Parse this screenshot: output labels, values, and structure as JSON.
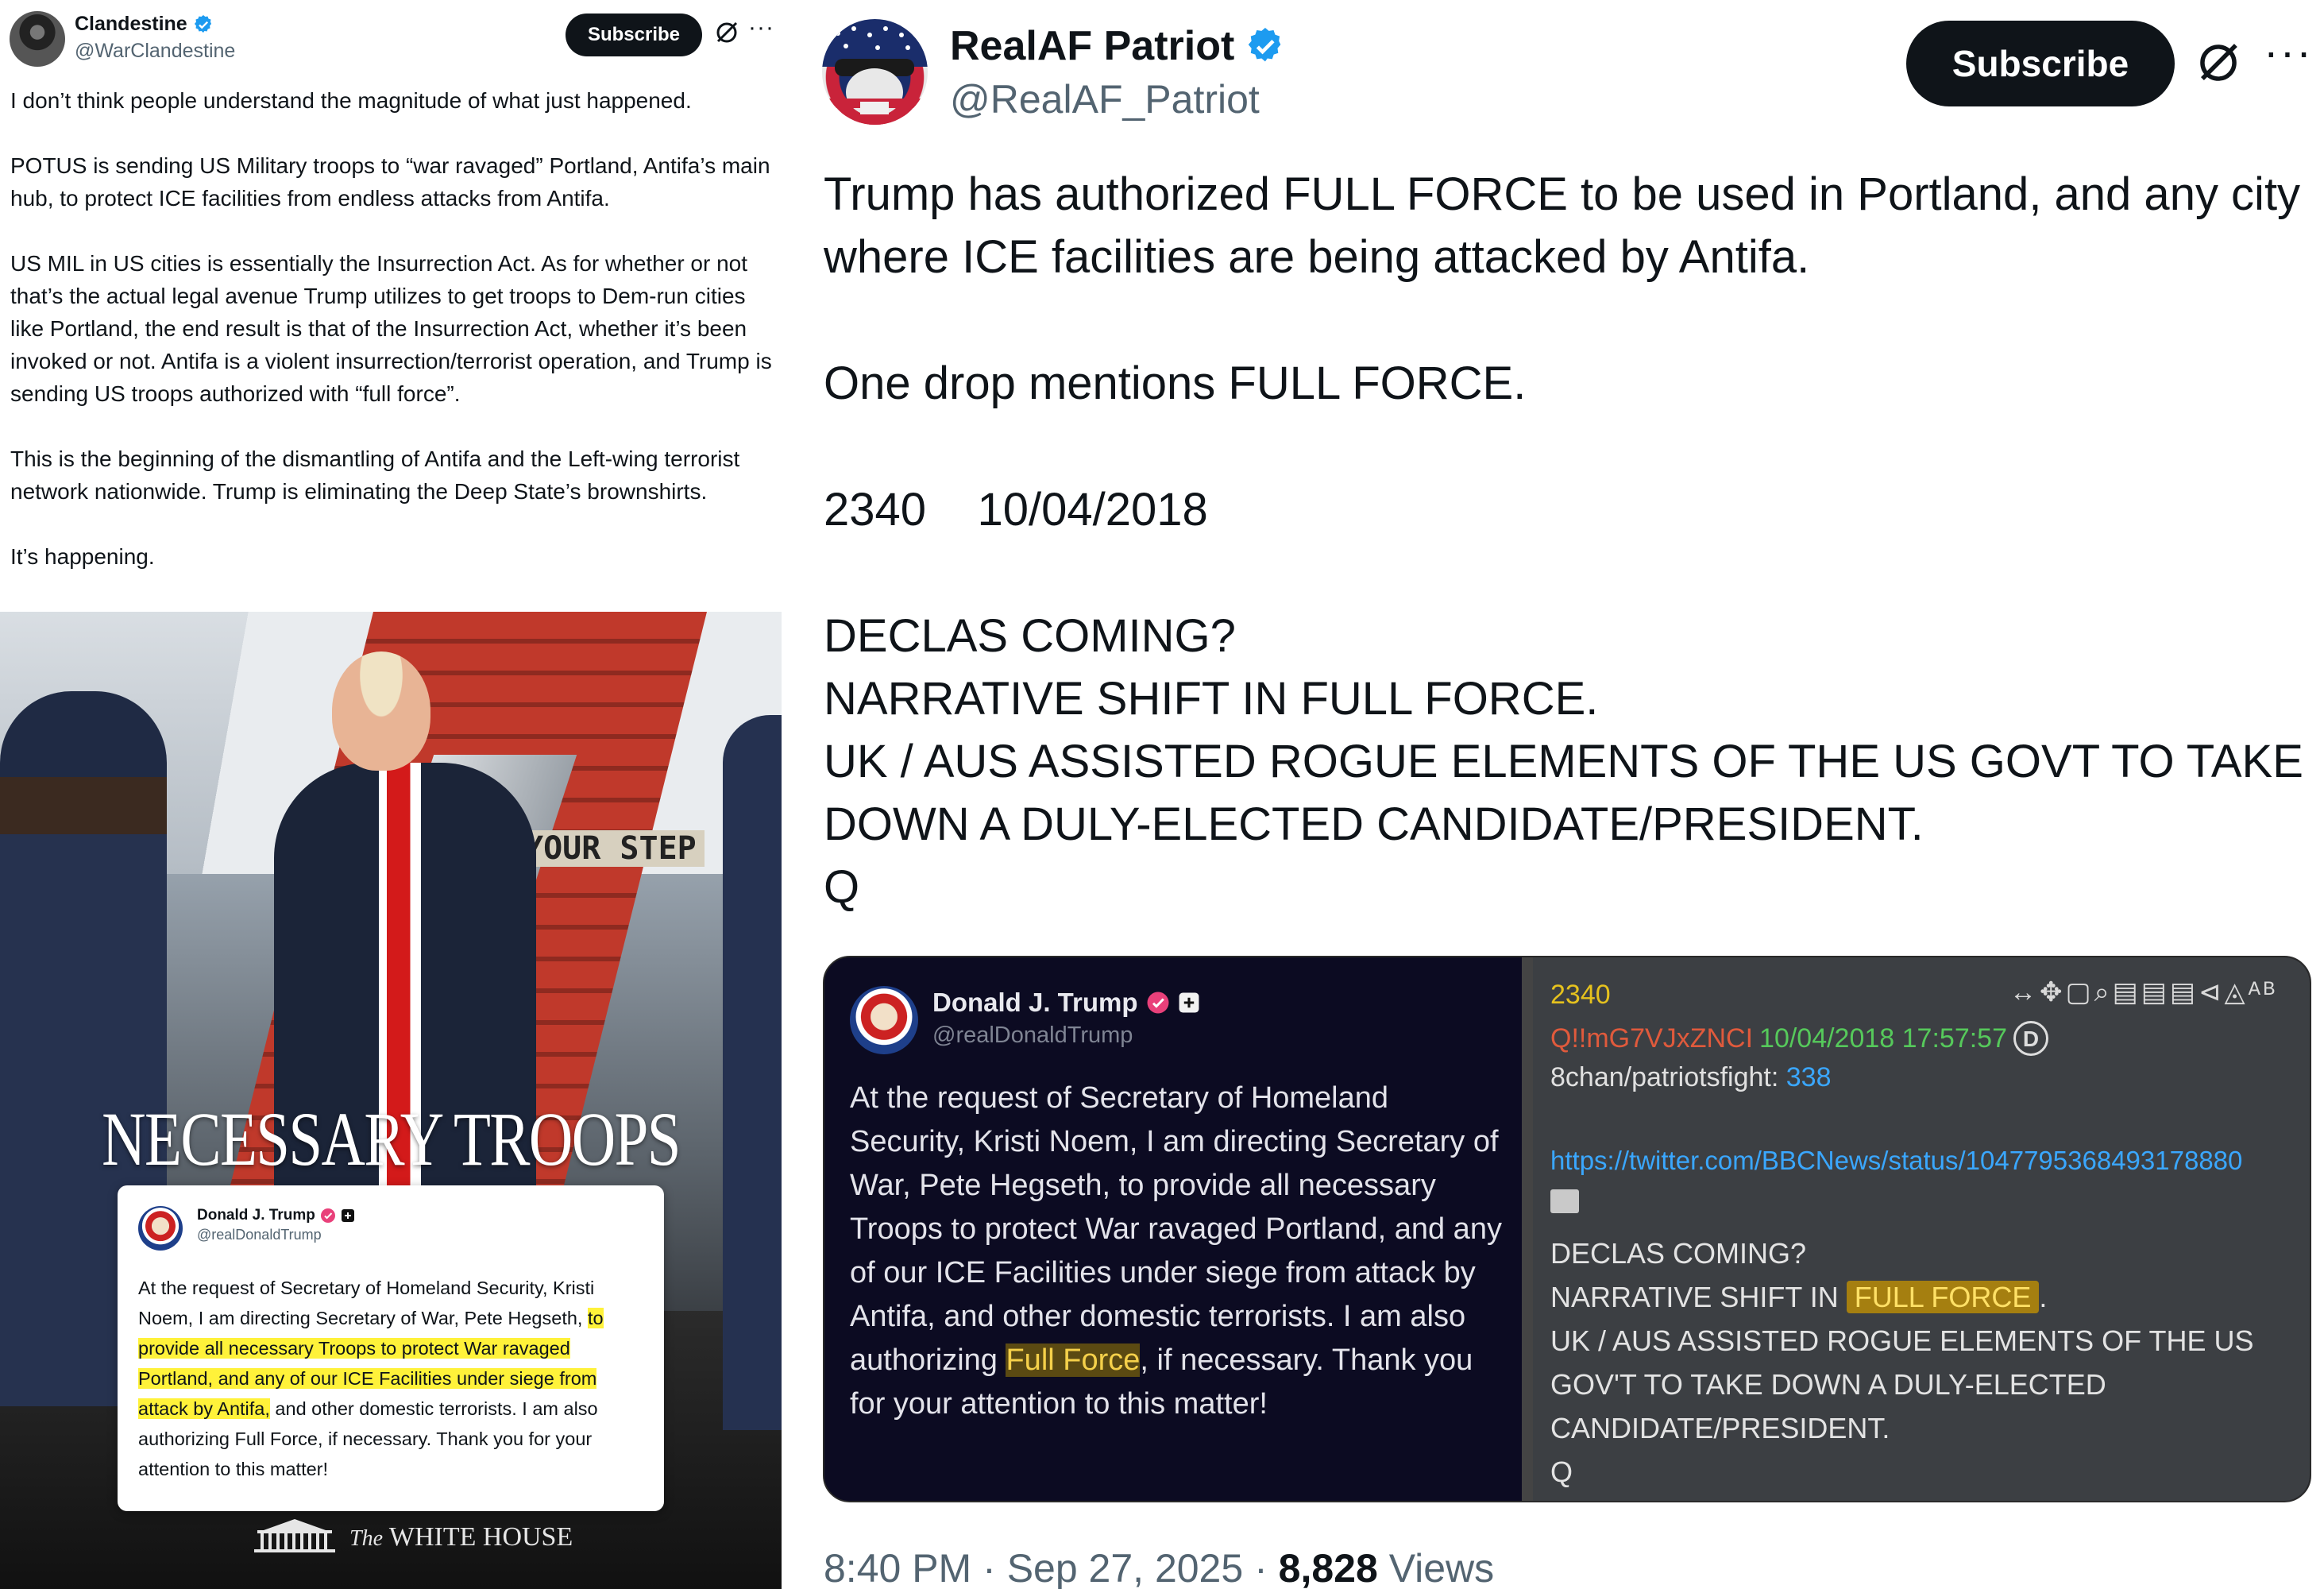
{
  "left_post": {
    "author_name": "Clandestine",
    "author_handle": "@WarClandestine",
    "subscribe_label": "Subscribe",
    "more_label": "···",
    "paragraphs": [
      "I don’t think people understand the magnitude of what just happened.",
      "POTUS is sending US Military troops to “war ravaged” Portland, Antifa’s main hub, to protect ICE facilities from endless attacks from Antifa.",
      "US MIL in US cities is essentially the Insurrection Act. As for whether or not that’s the actual legal avenue Trump utilizes to get troops to Dem-run cities like Portland, the end result is that of the Insurrection Act, whether it’s been invoked or not. Antifa is a violent insurrection/terrorist operation, and Trump is sending US troops authorized with “full force”.",
      "This is the beginning of the dismantling of Antifa and the Left-wing terrorist network nationwide. Trump is eliminating the Deep State’s brownshirts.",
      "It’s happening."
    ],
    "image": {
      "headline": "NECESSARY TROOPS",
      "stair_sign": "YOUR STEP",
      "card": {
        "name": "Donald J. Trump",
        "handle": "@realDonaldTrump",
        "body_before": "At the request of Secretary of Homeland Security, Kristi Noem, I am directing Secretary of War, Pete Hegseth, ",
        "body_highlight": "to provide all necessary Troops to protect War ravaged Portland, and any of our ICE Facilities under siege from attack by Antifa,",
        "body_after": " and other domestic terrorists. I am also authorizing Full Force, if necessary. Thank you for your attention to this matter!"
      },
      "footer_prefix": "The",
      "footer_text": "WHITE HOUSE"
    }
  },
  "right_post": {
    "author_name": "RealAF Patriot",
    "author_handle": "@RealAF_Patriot",
    "subscribe_label": "Subscribe",
    "more_label": "···",
    "paragraphs": [
      "Trump has authorized FULL FORCE to be used in Portland, and any city where ICE facilities are being attacked by Antifa.",
      "One drop mentions FULL FORCE.",
      "2340    10/04/2018",
      "DECLAS COMING?\nNARRATIVE SHIFT IN FULL FORCE.\nUK / AUS ASSISTED ROGUE ELEMENTS OF THE US GOVT TO TAKE DOWN A DULY-ELECTED CANDIDATE/PRESIDENT.\nQ"
    ],
    "embed": {
      "truth": {
        "name": "Donald J. Trump",
        "handle": "@realDonaldTrump",
        "body_before": "At the request of Secretary of Homeland Security, Kristi Noem, I am directing Secretary of War, Pete Hegseth, to provide all necessary Troops to protect War ravaged Portland, and any of our ICE Facilities under siege from attack by Antifa, and other domestic terrorists. I am also authorizing ",
        "body_highlight": "Full Force",
        "body_after": ", if necessary. Thank you for your attention to this matter!"
      },
      "drop": {
        "number": "2340",
        "tools": "↔✥▢⌕▤▤▤⊲◬ᴬᴮ",
        "tripcode": "Q!!mG7VJxZNCI",
        "datetime": "10/04/2018 17:57:57",
        "id_badge": "D",
        "board_prefix": "8chan/patriotsfight:",
        "board_number": "338",
        "link": "https://twitter.com/BBCNews/status/1047795368493178880",
        "line1": "DECLAS COMING?",
        "line2_before": "NARRATIVE SHIFT IN ",
        "line2_highlight": "FULL FORCE",
        "line2_after": ".",
        "line3": "UK / AUS ASSISTED ROGUE ELEMENTS OF THE US GOV'T TO TAKE DOWN A DULY-ELECTED CANDIDATE/PRESIDENT.",
        "line4": "Q"
      }
    },
    "footer": {
      "time": "8:40 PM",
      "sep": "·",
      "date": "Sep 27, 2025",
      "views_count": "8,828",
      "views_label": "Views"
    }
  },
  "colors": {
    "verified_blue": "#1d9bf0",
    "highlight_yellow": "#fff23a",
    "q_number": "#e6c21e",
    "q_trip": "#e05a3c",
    "q_date": "#56c95b",
    "link_blue": "#3aa7ff"
  }
}
